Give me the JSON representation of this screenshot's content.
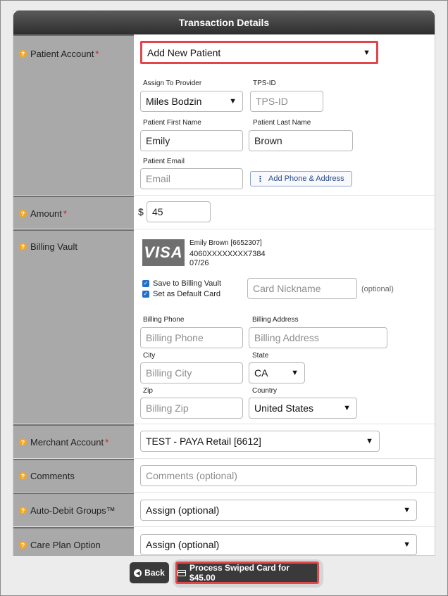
{
  "header": {
    "title": "Transaction Details"
  },
  "patient_account": {
    "label": "Patient Account",
    "required": "*",
    "select_value": "Add New Patient",
    "assign_provider_label": "Assign To Provider",
    "assign_provider_value": "Miles Bodzin",
    "tps_label": "TPS-ID",
    "tps_placeholder": "TPS-ID",
    "first_name_label": "Patient First Name",
    "first_name_value": "Emily",
    "last_name_label": "Patient Last Name",
    "last_name_value": "Brown",
    "email_label": "Patient Email",
    "email_placeholder": "Email",
    "add_phone_label": "Add Phone & Address"
  },
  "amount": {
    "label": "Amount",
    "required": "*",
    "currency": "$",
    "value": "45"
  },
  "billing_vault": {
    "label": "Billing Vault",
    "card_brand": "VISA",
    "card_name": "Emily Brown [6652307]",
    "card_number": "4060XXXXXXXX7384",
    "card_exp": "07/26",
    "save_label": "Save to Billing Vault",
    "default_label": "Set as Default Card",
    "nickname_placeholder": "Card Nickname",
    "optional_note": "(optional)",
    "phone_label": "Billing Phone",
    "phone_placeholder": "Billing Phone",
    "address_label": "Billing Address",
    "address_placeholder": "Billing Address",
    "city_label": "City",
    "city_placeholder": "Billing City",
    "state_label": "State",
    "state_value": "CA",
    "zip_label": "Zip",
    "zip_placeholder": "Billing Zip",
    "country_label": "Country",
    "country_value": "United States"
  },
  "merchant_account": {
    "label": "Merchant Account",
    "required": "*",
    "value": "TEST - PAYA Retail [6612]"
  },
  "comments": {
    "label": "Comments",
    "placeholder": "Comments (optional)"
  },
  "auto_debit": {
    "label": "Auto-Debit Groups™",
    "value": "Assign (optional)"
  },
  "care_plan": {
    "label": "Care Plan Option",
    "value": "Assign (optional)"
  },
  "buttons": {
    "back": "Back",
    "process": "Process Swiped Card for $45.00"
  },
  "colors": {
    "highlight": "#e0474c",
    "label_bg": "#a9a9a9",
    "help_icon": "#f2a623",
    "checkbox": "#2370c9"
  }
}
